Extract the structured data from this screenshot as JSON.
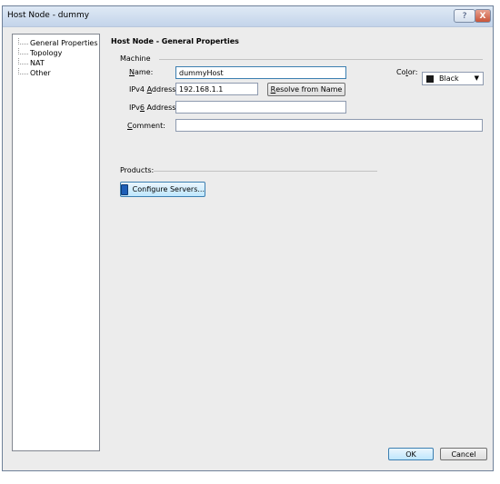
{
  "window": {
    "title": "Host Node - dummy",
    "help_glyph": "?",
    "close_glyph": "X"
  },
  "tree": {
    "items": [
      {
        "label": "General Properties"
      },
      {
        "label": "Topology"
      },
      {
        "label": "NAT"
      },
      {
        "label": "Other"
      }
    ]
  },
  "page": {
    "heading": "Host Node - General Properties",
    "machine_group": "Machine",
    "products_group": "Products:"
  },
  "fields": {
    "name": {
      "label_pre": "",
      "label_u": "N",
      "label_post": "ame:",
      "value": "dummyHost"
    },
    "ipv4": {
      "label_pre": "IPv4 ",
      "label_u": "A",
      "label_post": "ddress:",
      "value": "192.168.1.1"
    },
    "ipv6": {
      "label_pre": "IPv",
      "label_u": "6",
      "label_post": " Address:",
      "value": ""
    },
    "comment": {
      "label_pre": "",
      "label_u": "C",
      "label_post": "omment:",
      "value": ""
    },
    "color": {
      "label_pre": "Co",
      "label_u": "l",
      "label_post": "or:",
      "value": "Black",
      "swatch": "#1a1a1a"
    }
  },
  "buttons": {
    "resolve": {
      "pre": "",
      "u": "R",
      "post": "esolve from Name"
    },
    "configure_servers": "Configure Servers...",
    "ok": "OK",
    "cancel": "Cancel"
  },
  "icons": {
    "dropdown": "chevron-down-icon",
    "server": "server-icon"
  }
}
